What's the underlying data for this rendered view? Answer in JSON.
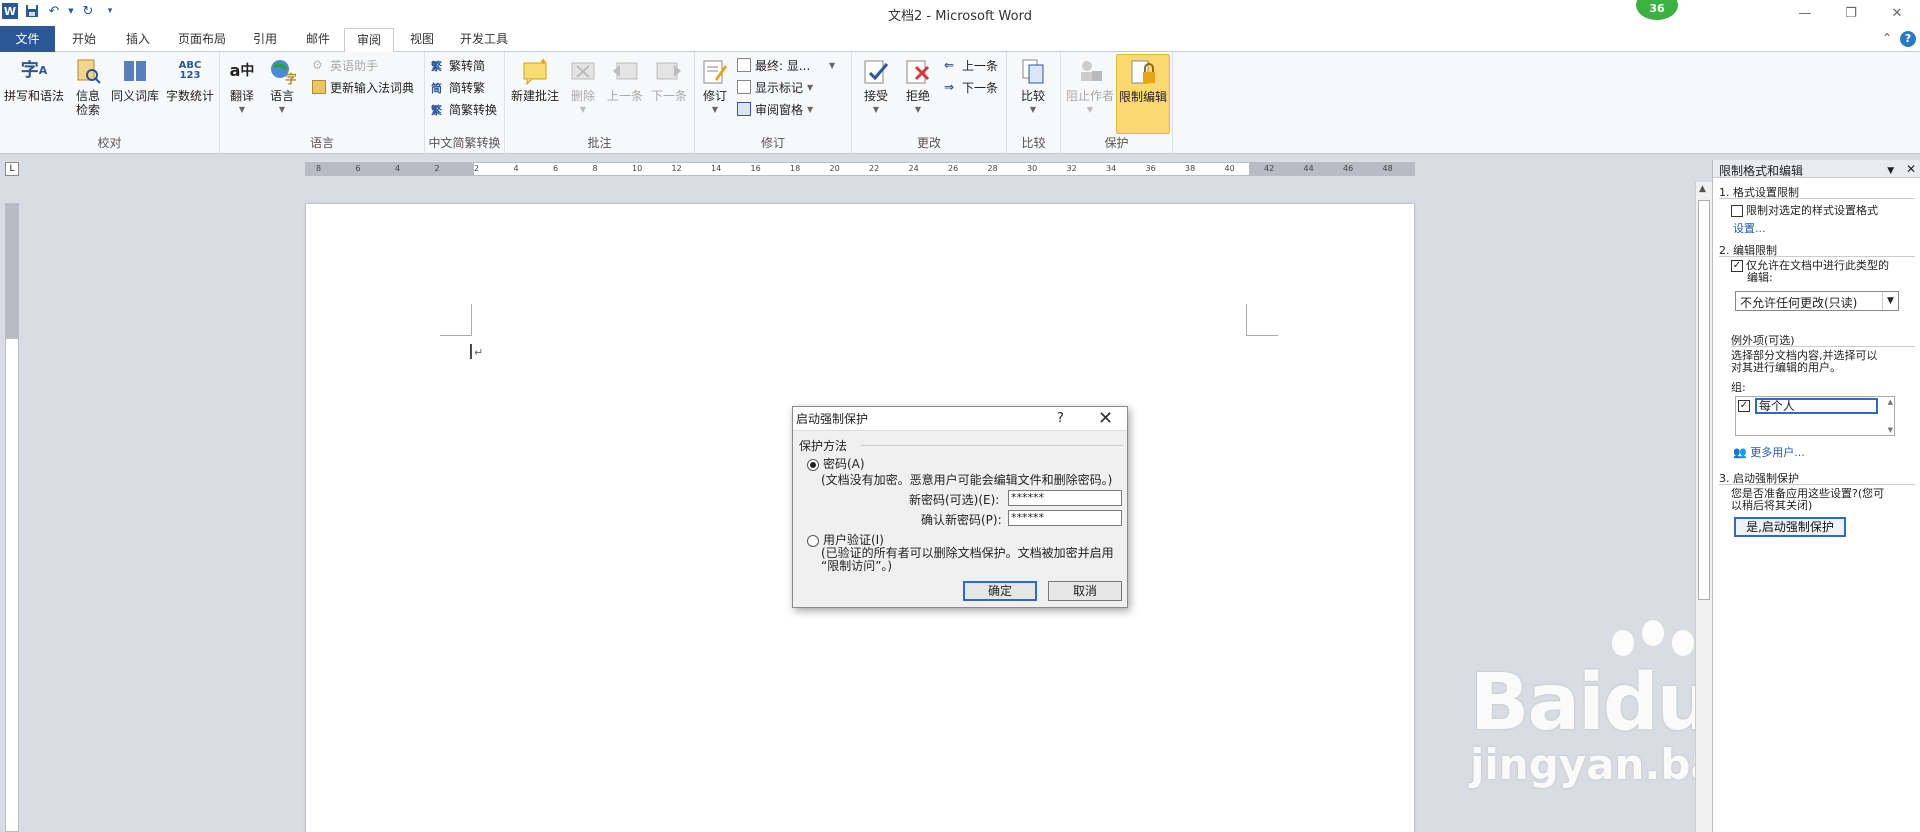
{
  "title_bar": {
    "title": "文档2 - Microsoft Word",
    "badge_count": "36"
  },
  "tabs": [
    {
      "label": "文件"
    },
    {
      "label": "开始"
    },
    {
      "label": "插入"
    },
    {
      "label": "页面布局"
    },
    {
      "label": "引用"
    },
    {
      "label": "邮件"
    },
    {
      "label": "审阅"
    },
    {
      "label": "视图"
    },
    {
      "label": "开发工具"
    }
  ],
  "ribbon": {
    "proofing": {
      "label": "校对",
      "spelling": "拼写和语法",
      "research_l1": "信息",
      "research_l2": "检索",
      "thesaurus": "同义词库",
      "wordcount": "字数统计"
    },
    "language": {
      "label": "语言",
      "translate": "翻译",
      "language": "语言",
      "english_assist": "英语助手",
      "update_ime": "更新输入法词典"
    },
    "chinese": {
      "label": "中文简繁转换",
      "to_simp": "繁转简",
      "to_trad": "简转繁",
      "convert": "简繁转换"
    },
    "comments": {
      "label": "批注",
      "new": "新建批注",
      "delete": "删除",
      "prev": "上一条",
      "next": "下一条"
    },
    "tracking": {
      "label": "修订",
      "track": "修订",
      "display_mode": "最终: 显...",
      "show_markup": "显示标记",
      "review_pane": "审阅窗格"
    },
    "changes": {
      "label": "更改",
      "accept": "接受",
      "reject": "拒绝",
      "prev": "上一条",
      "next": "下一条"
    },
    "compare": {
      "label": "比较",
      "compare": "比较"
    },
    "protect": {
      "label": "保护",
      "block_authors": "阻止作者",
      "restrict_editing": "限制编辑"
    }
  },
  "ruler": {
    "ticks": [
      "8",
      "6",
      "4",
      "2",
      "2",
      "4",
      "6",
      "8",
      "10",
      "12",
      "14",
      "16",
      "18",
      "20",
      "22",
      "24",
      "26",
      "28",
      "30",
      "32",
      "34",
      "36",
      "38",
      "40",
      "42",
      "44",
      "46",
      "48"
    ]
  },
  "task_pane": {
    "title": "限制格式和编辑",
    "sec1_title": "1. 格式设置限制",
    "sec1_check": "限制对选定的样式设置格式",
    "sec1_link": "设置...",
    "sec2_title": "2. 编辑限制",
    "sec2_check_l1": "仅允许在文档中进行此类型的",
    "sec2_check_l2": "编辑:",
    "edit_type": "不允许任何更改(只读)",
    "exceptions_title": "例外项(可选)",
    "exceptions_desc_l1": "选择部分文档内容,并选择可以",
    "exceptions_desc_l2": "对其进行编辑的用户。",
    "groups_label": "组:",
    "group_everyone": "每个人",
    "more_users": "更多用户...",
    "sec3_title": "3. 启动强制保护",
    "sec3_desc_l1": "您是否准备应用这些设置?(您可",
    "sec3_desc_l2": "以稍后将其关闭)",
    "start_button": "是,启动强制保护"
  },
  "dialog": {
    "title": "启动强制保护",
    "help": "?",
    "group_label": "保护方法",
    "password_option": "密码(A)",
    "password_note": "(文档没有加密。恶意用户可能会编辑文件和删除密码。)",
    "new_password_label": "新密码(可选)(E):",
    "new_password_value": "******",
    "confirm_password_label": "确认新密码(P):",
    "confirm_password_value": "******",
    "user_auth_option": "用户验证(I)",
    "user_auth_note_l1": "(已验证的所有者可以删除文档保护。文档被加密并启用",
    "user_auth_note_l2": "“限制访问”。)",
    "ok": "确定",
    "cancel": "取消"
  },
  "watermark": {
    "logo": "Baidu经验",
    "url": "jingyan.baidu.com"
  }
}
